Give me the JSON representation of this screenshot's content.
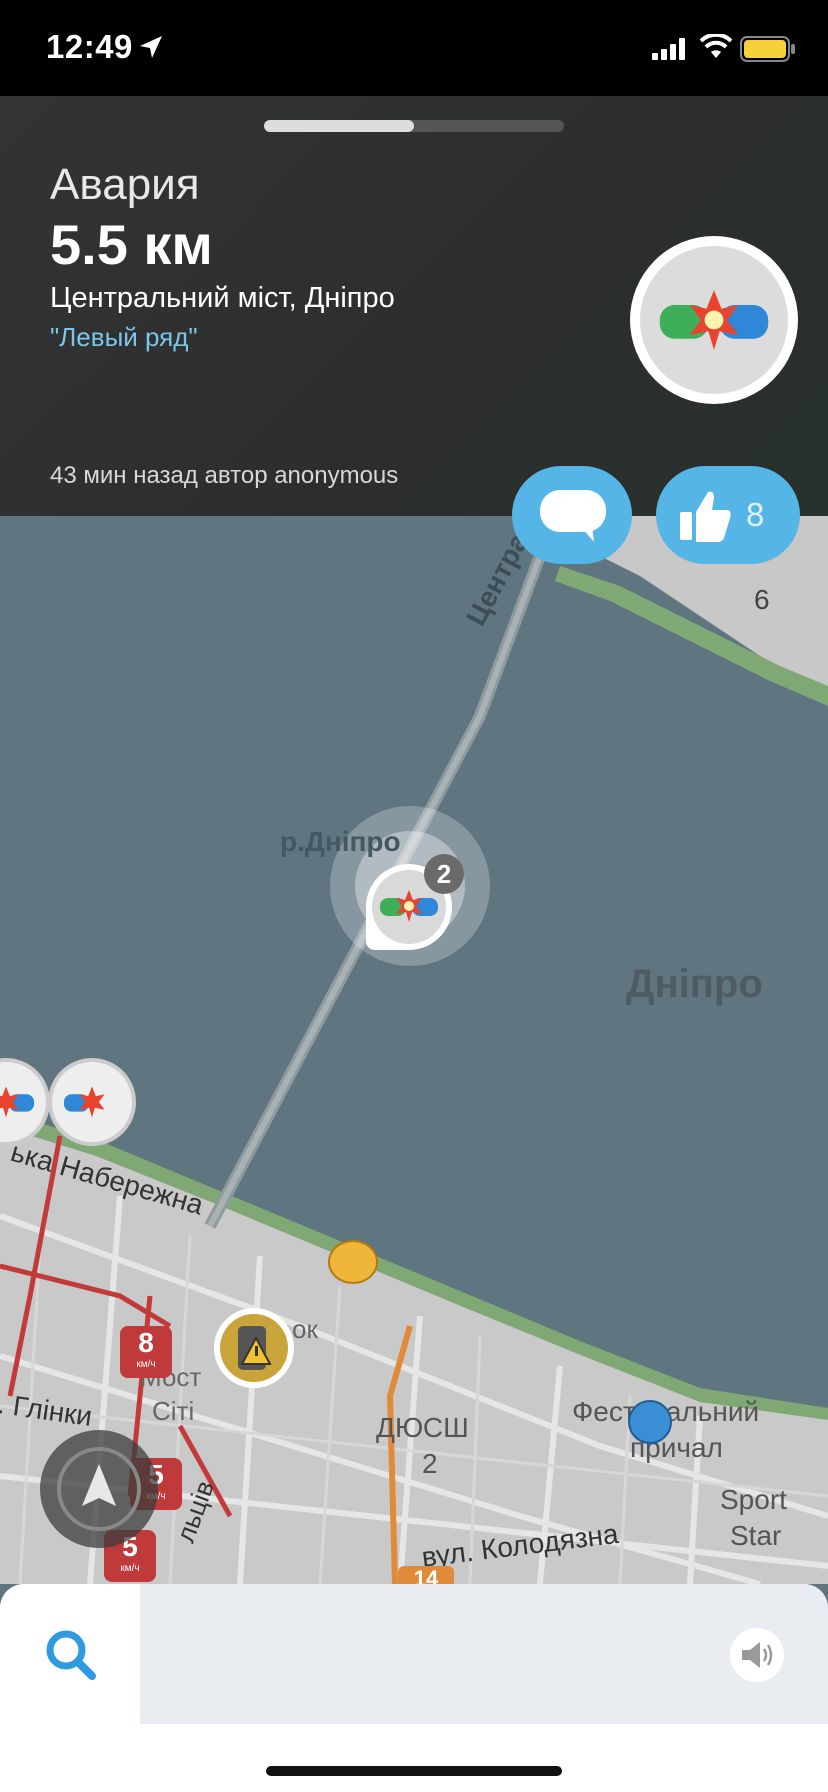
{
  "status_bar": {
    "time": "12:49",
    "icons": [
      "location-arrow-icon",
      "cellular-signal-icon",
      "wifi-icon",
      "battery-icon"
    ]
  },
  "alert": {
    "type": "Авария",
    "distance": "5.5 км",
    "street": "Центральний міст, Дніпро",
    "comment": "\"Левый ряд\"",
    "meta": "43 мин назад автор anonymous",
    "icon": "car-crash-icon",
    "likes": "8"
  },
  "map": {
    "road_central": "Центральни",
    "river": "р.Дніпро",
    "city": "Дніпро",
    "embankment": "ька Набережна",
    "glinki": ". Глінки",
    "most": "Мост",
    "siti": "Сіті",
    "dyush": "ДЮСШ",
    "dyush_num": "2",
    "fest1": "Фестивальний",
    "fest2": "причал",
    "sport1": "Sport",
    "sport2": "Star",
    "kolodyazna": "вул. Колодязна",
    "tsiv": "льців",
    "ok": "ок",
    "block_num": "6",
    "cluster_count": "2",
    "speed_unit": "км/ч",
    "speeds": [
      "8",
      "5",
      "5"
    ],
    "route_num": "14"
  },
  "colors": {
    "card_bg": "#2f3131",
    "accent": "#54b5e6",
    "comment": "#7ac6ea",
    "water": "#5f7580",
    "land": "#c9c9c9"
  }
}
